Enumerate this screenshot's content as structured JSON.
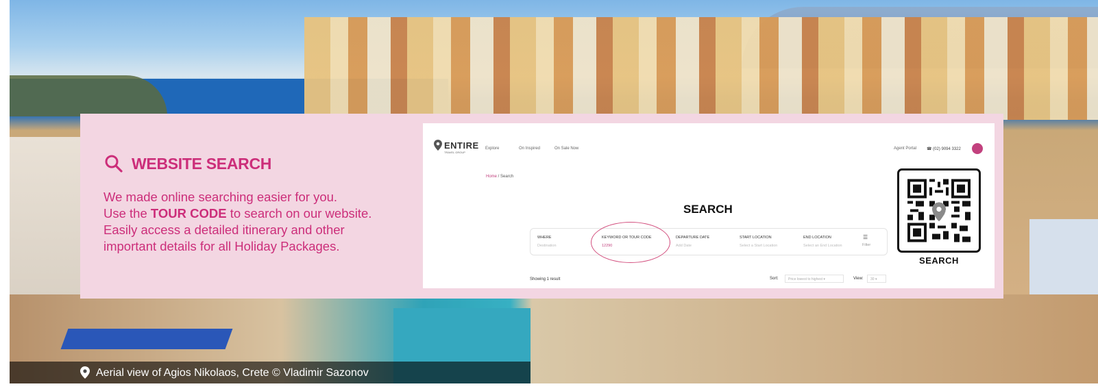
{
  "panel": {
    "heading": "WEBSITE SEARCH",
    "line1": "We made online searching easier for you.",
    "line2_pre": "Use the ",
    "line2_bold": "TOUR CODE",
    "line2_post": " to search on our website.",
    "line3": "Easily access a detailed itinerary and other",
    "line4": "important details for all Holiday Packages."
  },
  "site": {
    "logo": "ENTIRE",
    "logo_sub": "TRAVEL GROUP",
    "nav": [
      "Explore",
      "On Inspired",
      "On Sale Now"
    ],
    "agent_portal": "Agent Portal",
    "phone": "(02) 9094 3322",
    "breadcrumb_home": "Home",
    "breadcrumb_sep": " / ",
    "breadcrumb_current": "Search",
    "title": "SEARCH",
    "fields": [
      {
        "label": "WHERE",
        "placeholder": "Destination"
      },
      {
        "label": "KEYWORD OR TOUR CODE",
        "value": "12290"
      },
      {
        "label": "DEPARTURE DATE",
        "placeholder": "Add Date"
      },
      {
        "label": "START LOCATION",
        "placeholder": "Select a Start Location"
      },
      {
        "label": "END LOCATION",
        "placeholder": "Select an End Location"
      }
    ],
    "filter": "Filter",
    "showing": "Showing 1 result",
    "sort_label": "Sort:",
    "sort_value": "Price lowest to highest ▾",
    "view_label": "View:",
    "view_value": "30 ▾"
  },
  "qr": {
    "label": "SEARCH"
  },
  "caption": {
    "text": "Aerial view of Agios Nikolaos, Crete © Vladimir Sazonov"
  },
  "colors": {
    "accent": "#cc2e7a",
    "panel_bg": "#f3d6e2"
  }
}
